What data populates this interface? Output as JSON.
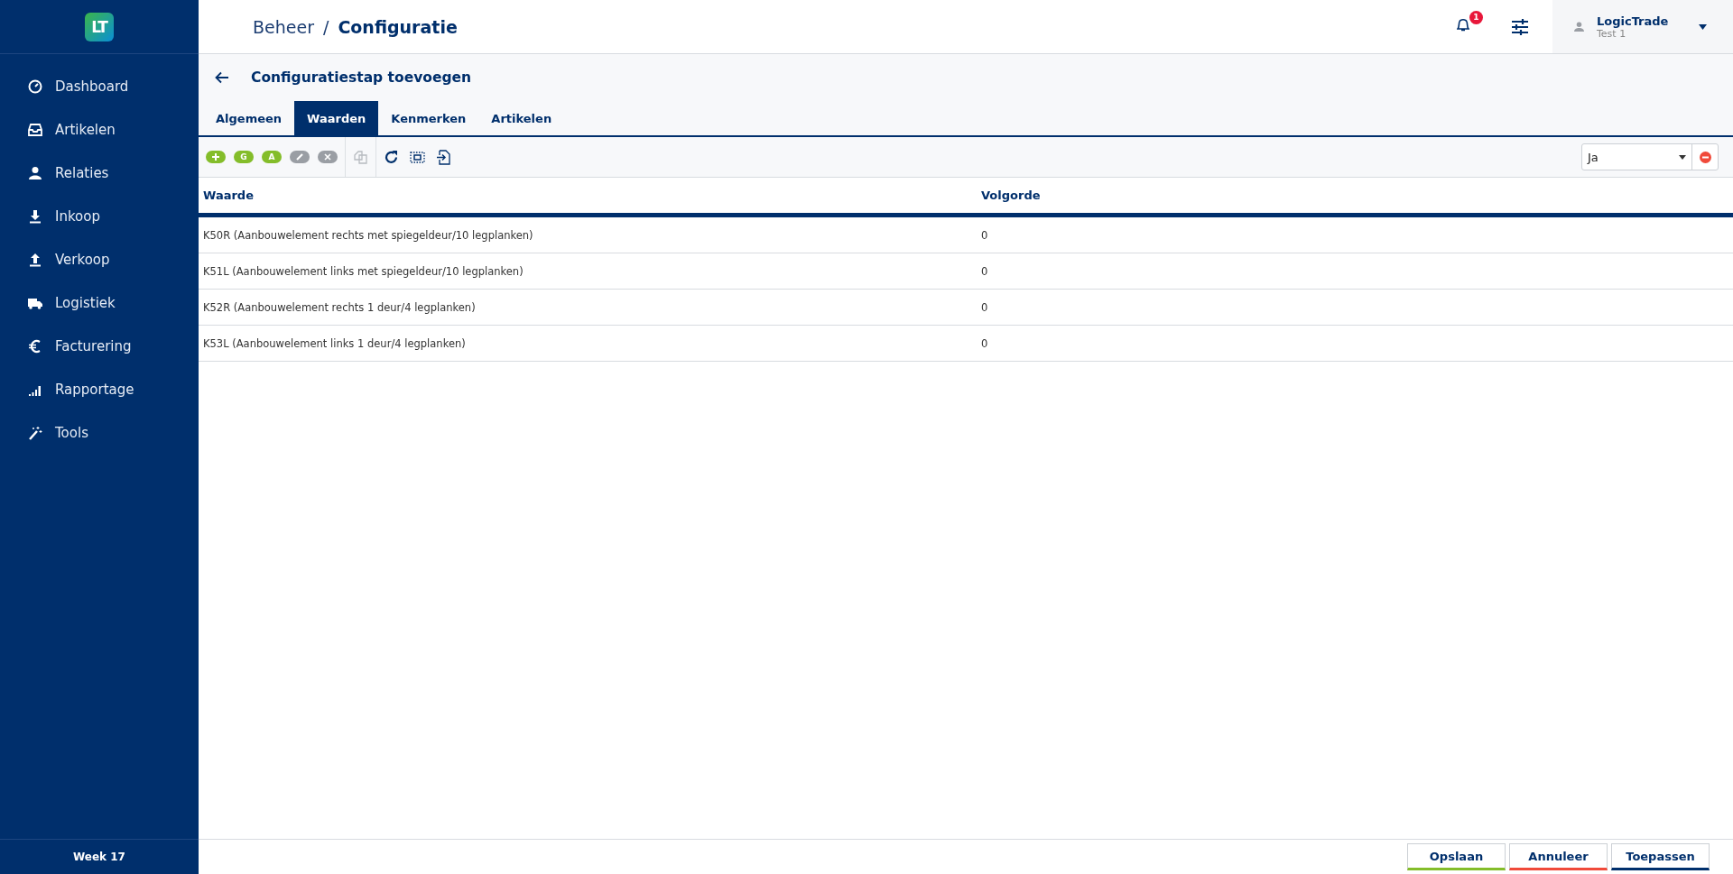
{
  "sidebar": {
    "logo": "LT",
    "items": [
      {
        "label": "Dashboard"
      },
      {
        "label": "Artikelen"
      },
      {
        "label": "Relaties"
      },
      {
        "label": "Inkoop"
      },
      {
        "label": "Verkoop"
      },
      {
        "label": "Logistiek"
      },
      {
        "label": "Facturering"
      },
      {
        "label": "Rapportage"
      },
      {
        "label": "Tools"
      }
    ],
    "footer": "Week 17"
  },
  "header": {
    "breadcrumb": [
      "Beheer",
      "/",
      "Configuratie"
    ],
    "notifications": "1",
    "user": {
      "name": "LogicTrade",
      "subtitle": "Test 1"
    }
  },
  "page": {
    "title": "Configuratiestap toevoegen"
  },
  "tabs": [
    {
      "label": "Algemeen",
      "selected": false
    },
    {
      "label": "Waarden",
      "selected": true
    },
    {
      "label": "Kenmerken",
      "selected": false
    },
    {
      "label": "Artikelen",
      "selected": false
    }
  ],
  "toolbar": {
    "buttons": [
      {
        "kind": "add",
        "disabled": false
      },
      {
        "kind": "letter",
        "label": "G",
        "disabled": false
      },
      {
        "kind": "letter",
        "label": "A",
        "disabled": false
      },
      {
        "kind": "edit",
        "disabled": true
      },
      {
        "kind": "delete",
        "disabled": true
      }
    ],
    "filter": {
      "value": "Ja"
    }
  },
  "table": {
    "columns": [
      "Waarde",
      "Volgorde"
    ],
    "rows": [
      [
        "K50R (Aanbouwelement rechts met spiegeldeur/10 legplanken)",
        "0"
      ],
      [
        "K51L (Aanbouwelement links met spiegeldeur/10 legplanken)",
        "0"
      ],
      [
        "K52R (Aanbouwelement rechts 1 deur/4 legplanken)",
        "0"
      ],
      [
        "K53L (Aanbouwelement links 1 deur/4 legplanken)",
        "0"
      ]
    ]
  },
  "footer_buttons": [
    {
      "label": "Opslaan",
      "color": "#84bd2a"
    },
    {
      "label": "Annuleer",
      "color": "#f04a3a"
    },
    {
      "label": "Toepassen",
      "color": "#002f6c"
    }
  ]
}
